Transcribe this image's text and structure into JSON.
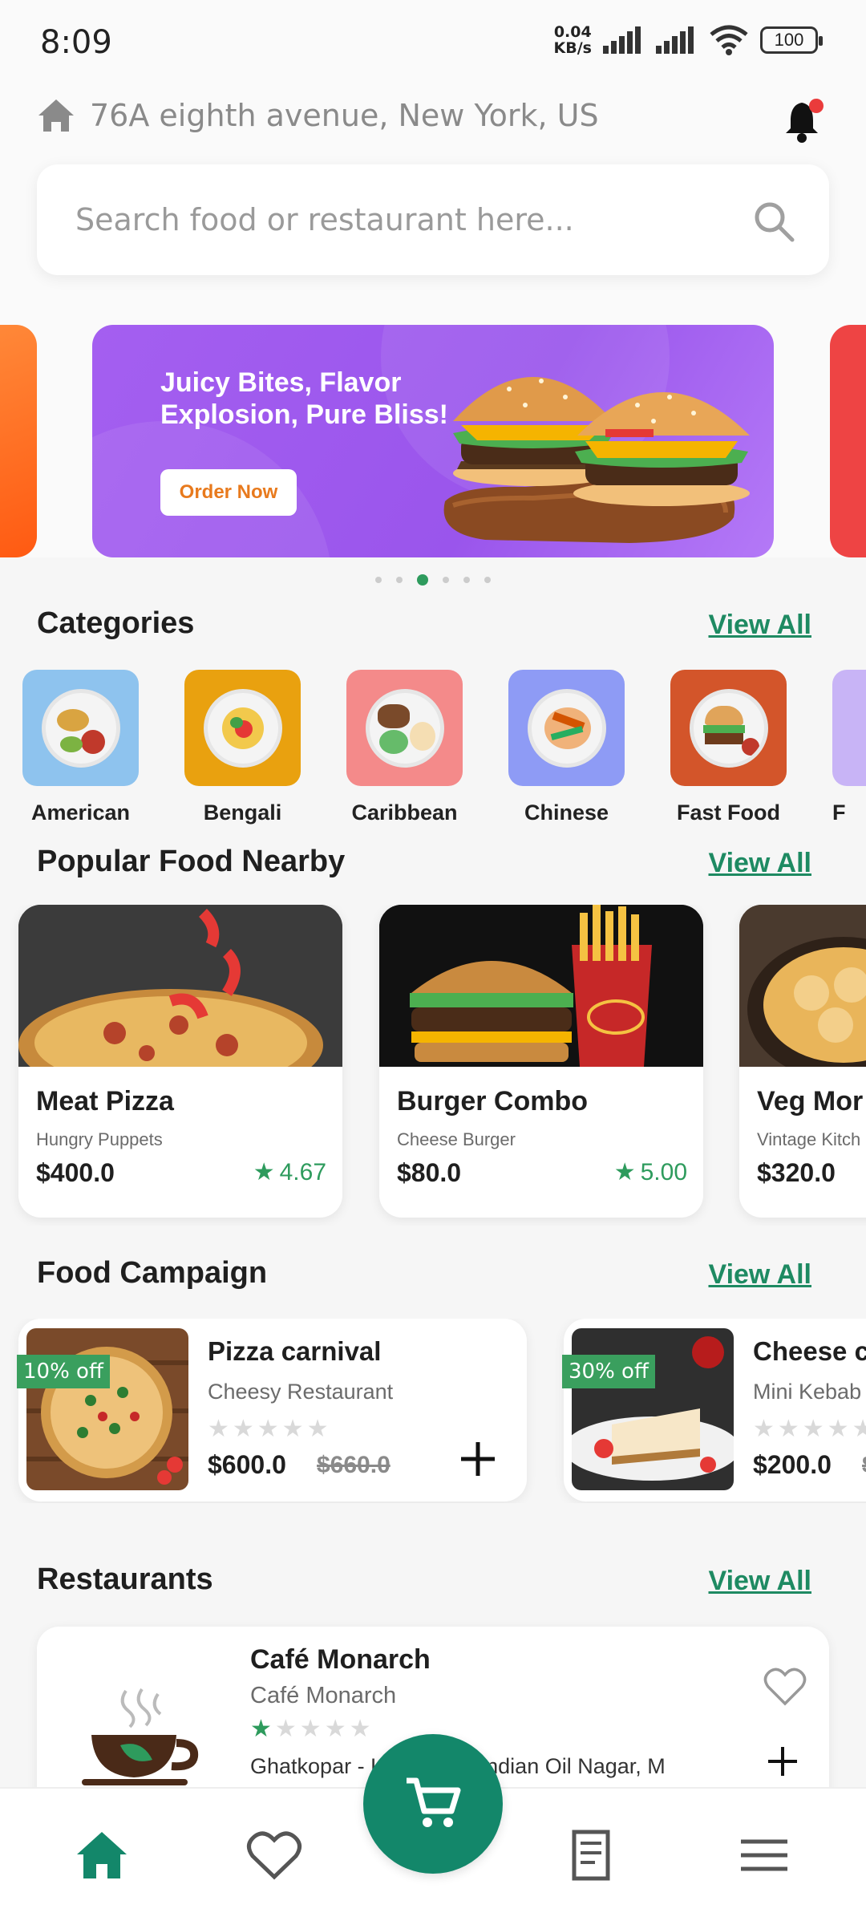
{
  "status_bar": {
    "time": "8:09",
    "speed_value": "0.04",
    "speed_unit": "KB/s",
    "battery": "100"
  },
  "header": {
    "address": "76A eighth avenue, New York, US",
    "search_placeholder": "Search food or restaurant here..."
  },
  "banner": {
    "title": "Juicy Bites, Flavor Explosion, Pure Bliss!",
    "button_label": "Order Now",
    "active_index": 2,
    "slides": 6
  },
  "categories": {
    "title": "Categories",
    "view_all": "View All",
    "items": [
      {
        "label": "American",
        "color": "#8ec3ee"
      },
      {
        "label": "Bengali",
        "color": "#e9a10f"
      },
      {
        "label": "Caribbean",
        "color": "#f48a8a"
      },
      {
        "label": "Chinese",
        "color": "#8e9bf5"
      },
      {
        "label": "Fast Food",
        "color": "#d3552a"
      },
      {
        "label": "F",
        "color": "#c8b4f6"
      }
    ]
  },
  "popular": {
    "title": "Popular Food Nearby",
    "view_all": "View All",
    "items": [
      {
        "name": "Meat Pizza",
        "restaurant": "Hungry Puppets",
        "price": "$400.0",
        "rating": "4.67"
      },
      {
        "name": "Burger Combo",
        "restaurant": "Cheese Burger",
        "price": "$80.0",
        "rating": "5.00"
      },
      {
        "name": "Veg Mor",
        "restaurant": "Vintage Kitch",
        "price": "$320.0",
        "rating": ""
      }
    ]
  },
  "campaign": {
    "title": "Food Campaign",
    "view_all": "View All",
    "items": [
      {
        "name": "Pizza carnival",
        "restaurant": "Cheesy Restaurant",
        "price": "$600.0",
        "old_price": "$660.0",
        "discount": "10% off"
      },
      {
        "name": "Cheese c",
        "restaurant": "Mini Kebab",
        "price": "$200.0",
        "old_price": "$",
        "discount": "30% off"
      }
    ]
  },
  "restaurants": {
    "title": "Restaurants",
    "view_all": "View All",
    "items": [
      {
        "name": "Café Monarch",
        "subtitle": "Café Monarch",
        "address": "Ghatkopar - Link Road, Indian Oil Nagar, M",
        "rating_stars": 1
      }
    ]
  },
  "colors": {
    "accent": "#13876a",
    "link": "#1e8a62",
    "rating": "#2e9b5d",
    "banner": "#a45ff0",
    "notification_dot": "#ea3b3b"
  },
  "nav": {
    "items": [
      "home-icon",
      "heart-icon",
      "cart-icon",
      "orders-icon",
      "menu-icon"
    ],
    "active": "home-icon"
  }
}
